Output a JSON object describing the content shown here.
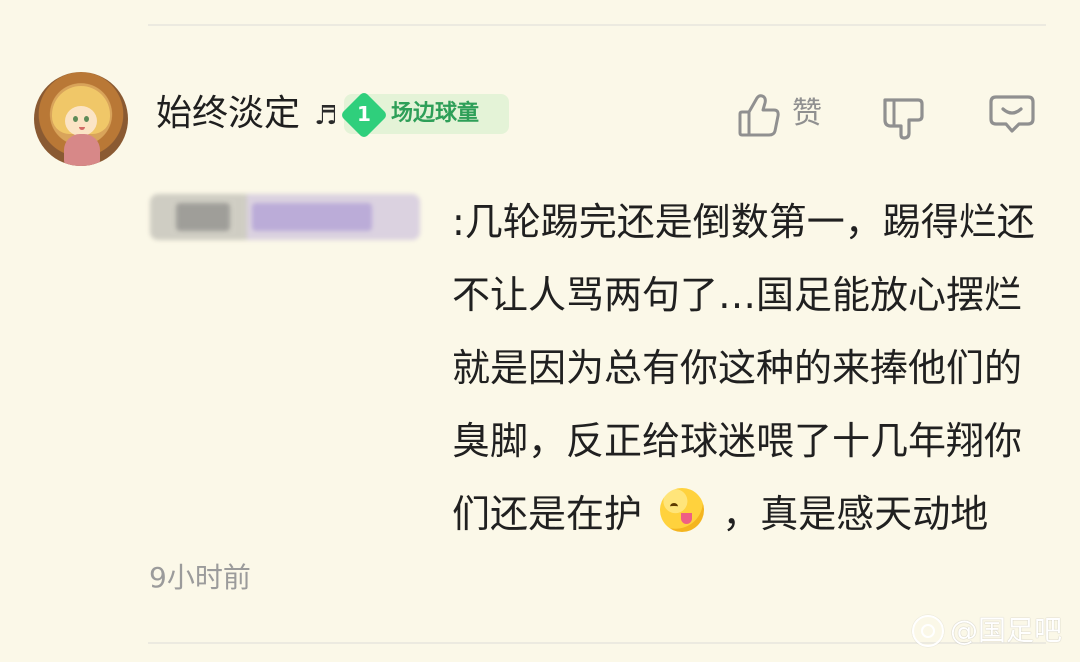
{
  "comment": {
    "username": "始终淡定",
    "username_note": "♬",
    "badge": {
      "level": "1",
      "label": "场边球童"
    },
    "actions": {
      "like_label": "赞",
      "like_icon": "thumbs-up-icon",
      "dislike_icon": "thumbs-down-icon",
      "reply_icon": "comment-icon"
    },
    "text_before_emoji": ":几轮踢完还是倒数第一，踢得烂还不让人骂两句了…国足能放心摆烂就是因为总有你这种的来捧他们的臭脚，反正给球迷喂了十几年翔你们还是在护",
    "emoji": "😋",
    "text_after_emoji": "，真是感天动地",
    "timestamp": "9小时前"
  },
  "watermark": {
    "icon": "tieba-logo-icon",
    "text": "@国足吧"
  },
  "colors": {
    "background": "#fbf8e8",
    "badge_background": "#e4f3d7",
    "badge_accent": "#2fcf7c",
    "badge_text": "#2e9f58",
    "muted_text": "#9b9b9b",
    "icon_gray": "#909090"
  }
}
